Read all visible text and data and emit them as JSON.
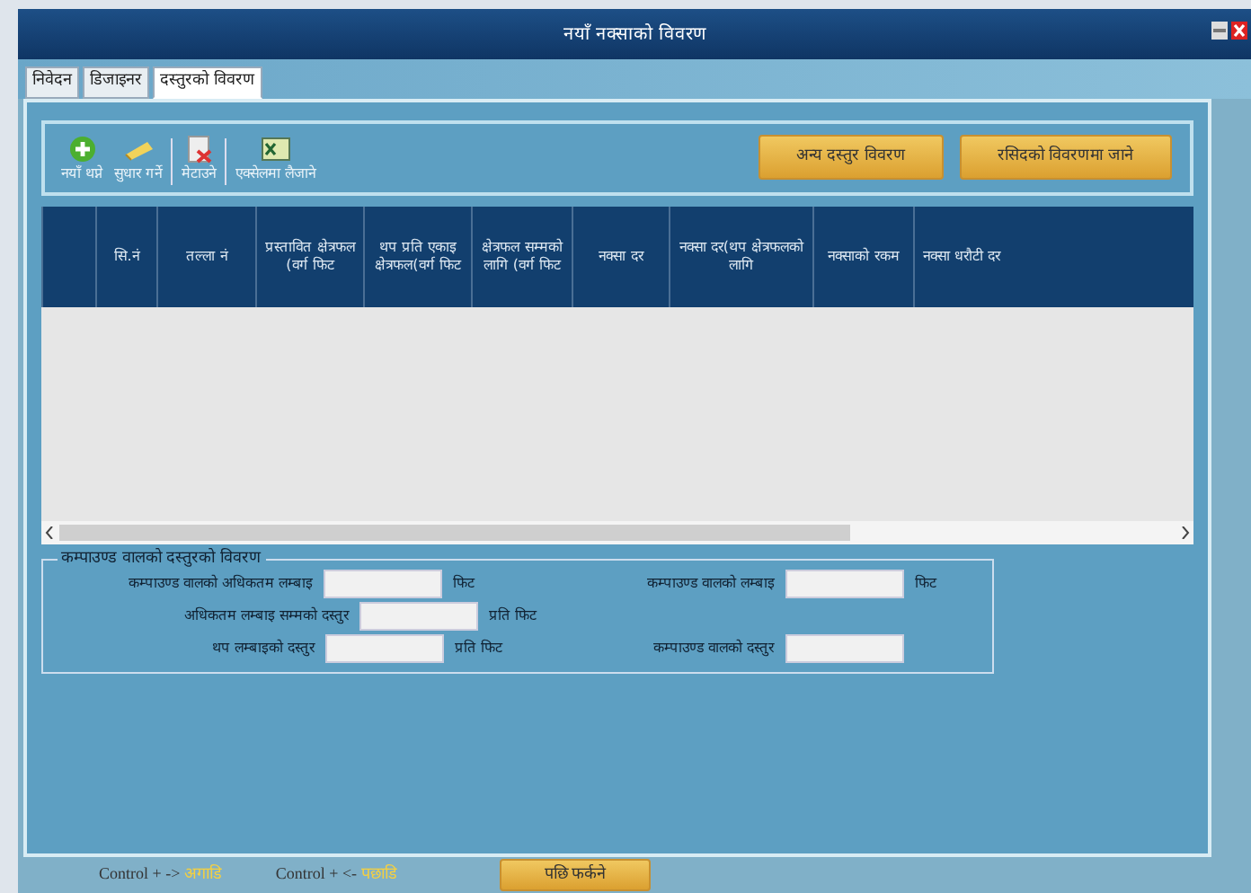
{
  "window": {
    "title": "नयाँ नक्साको विवरण"
  },
  "tabs": [
    {
      "label": "निवेदन",
      "selected": false
    },
    {
      "label": "डिजाइनर",
      "selected": false
    },
    {
      "label": "दस्तुरको विवरण",
      "selected": true
    }
  ],
  "toolbar": [
    {
      "label": "नयाँ थप्ने",
      "kind": "add"
    },
    {
      "label": "सुधार गर्ने",
      "kind": "edit"
    },
    {
      "label": "मेटाउने",
      "kind": "delete"
    },
    {
      "label": "एक्सेलमा लैजाने",
      "kind": "excel"
    }
  ],
  "action_buttons": [
    "अन्य दस्तुर विवरण",
    "रसिदको विवरणमा जाने"
  ],
  "table": {
    "columns": [
      "सि.नं",
      "तल्ला नं",
      "प्रस्तावित क्षेत्रफल (वर्ग फिट",
      "थप प्रति एकाइ क्षेत्रफल(वर्ग फिट",
      "क्षेत्रफल सम्मको लागि (वर्ग फिट",
      "नक्सा दर",
      "नक्सा दर(थप क्षेत्रफलको लागि",
      "नक्साको रकम",
      "नक्सा धरौटी दर"
    ]
  },
  "compound_wall": {
    "title": "कम्पाउण्ड वालको दस्तुरको विवरण",
    "left": [
      {
        "label": "कम्पाउण्ड वालको अधिकतम लम्बाइ",
        "unit": "फिट"
      },
      {
        "label": "अधिकतम लम्बाइ सम्मको दस्तुर",
        "unit": "प्रति फिट"
      },
      {
        "label": "थप लम्बाइको दस्तुर",
        "unit": "प्रति फिट"
      }
    ],
    "right": [
      {
        "label": "कम्पाउण्ड वालको लम्बाइ",
        "unit": "फिट"
      },
      {
        "label": "कम्पाउण्ड वालको दस्तुर"
      }
    ]
  },
  "footer": {
    "hints": [
      {
        "keys": "Control + ->",
        "action": "अगाडि"
      },
      {
        "keys": "Control + <-",
        "action": "पछाडि"
      }
    ],
    "button": "पछि फर्कने"
  }
}
